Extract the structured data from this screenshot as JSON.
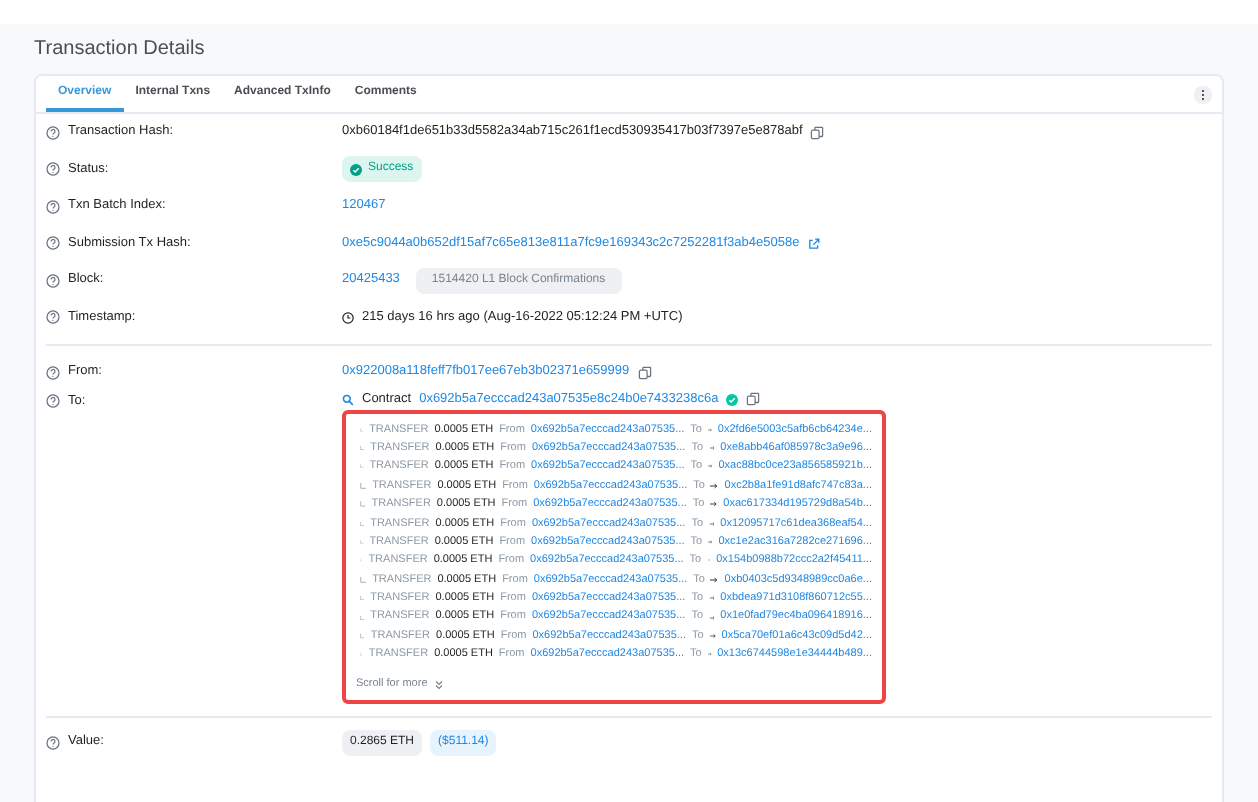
{
  "page_title": "Transaction Details",
  "tabs": [
    {
      "label": "Overview",
      "selected": true
    },
    {
      "label": "Internal Txns",
      "selected": false
    },
    {
      "label": "Advanced TxInfo",
      "selected": false
    },
    {
      "label": "Comments",
      "selected": false
    }
  ],
  "fields": [
    {
      "label": "Transaction Hash:",
      "kind": "hash",
      "value": "0xb60184f1de651b33d5582a34ab715c261f1ecd530935417b03f7397e5e878abf"
    },
    {
      "label": "Status:",
      "kind": "status",
      "value": "Success"
    },
    {
      "label": "Txn Batch Index:",
      "kind": "link",
      "value": "120467"
    },
    {
      "label": "Submission Tx Hash:",
      "kind": "external",
      "value": "0xe5c9044a0b652df15af7c65e813e811a7fc9e169343c2c7252281f3ab4e5058e"
    },
    {
      "label": "Block:",
      "kind": "block",
      "value": "20425433",
      "badge": "1514420 L1 Block Confirmations"
    },
    {
      "label": "Timestamp:",
      "kind": "time",
      "value": "215 days 16 hrs ago (Aug-16-2022 05:12:24 PM +UTC)"
    }
  ],
  "from": {
    "label": "From:",
    "value": "0x922008a118feff7fb017ee67eb3b02371e659999"
  },
  "to": {
    "label": "To:",
    "prefix": "Contract",
    "value": "0x692b5a7ecccad243a07535e8c24b0e7433238c6a",
    "transfers": [
      {
        "type": "TRANSFER",
        "amount": "0.0005 ETH",
        "from_label": "From",
        "from": "0x692b5a7ecccad243a07535...",
        "to_label": "To",
        "to": "0x2fd6e5003c5afb6cb64234e..."
      },
      {
        "type": "TRANSFER",
        "amount": "0.0005 ETH",
        "from_label": "From",
        "from": "0x692b5a7ecccad243a07535...",
        "to_label": "To",
        "to": "0xe8abb46af085978c3a9e96..."
      },
      {
        "type": "TRANSFER",
        "amount": "0.0005 ETH",
        "from_label": "From",
        "from": "0x692b5a7ecccad243a07535...",
        "to_label": "To",
        "to": "0xac88bc0ce23a856585921b..."
      },
      {
        "type": "TRANSFER",
        "amount": "0.0005 ETH",
        "from_label": "From",
        "from": "0x692b5a7ecccad243a07535...",
        "to_label": "To",
        "to": "0xc2b8a1fe91d8afc747c83a..."
      },
      {
        "type": "TRANSFER",
        "amount": "0.0005 ETH",
        "from_label": "From",
        "from": "0x692b5a7ecccad243a07535...",
        "to_label": "To",
        "to": "0xac617334d195729d8a54b..."
      },
      {
        "type": "TRANSFER",
        "amount": "0.0005 ETH",
        "from_label": "From",
        "from": "0x692b5a7ecccad243a07535...",
        "to_label": "To",
        "to": "0x12095717c61dea368eaf54..."
      },
      {
        "type": "TRANSFER",
        "amount": "0.0005 ETH",
        "from_label": "From",
        "from": "0x692b5a7ecccad243a07535...",
        "to_label": "To",
        "to": "0xc1e2ac316a7282ce271696..."
      },
      {
        "type": "TRANSFER",
        "amount": "0.0005 ETH",
        "from_label": "From",
        "from": "0x692b5a7ecccad243a07535...",
        "to_label": "To",
        "to": "0x154b0988b72ccc2a2f45411..."
      },
      {
        "type": "TRANSFER",
        "amount": "0.0005 ETH",
        "from_label": "From",
        "from": "0x692b5a7ecccad243a07535...",
        "to_label": "To",
        "to": "0xb0403c5d9348989cc0a6e..."
      },
      {
        "type": "TRANSFER",
        "amount": "0.0005 ETH",
        "from_label": "From",
        "from": "0x692b5a7ecccad243a07535...",
        "to_label": "To",
        "to": "0xbdea971d3108f860712c55..."
      },
      {
        "type": "TRANSFER",
        "amount": "0.0005 ETH",
        "from_label": "From",
        "from": "0x692b5a7ecccad243a07535...",
        "to_label": "To",
        "to": "0x1e0fad79ec4ba096418916..."
      },
      {
        "type": "TRANSFER",
        "amount": "0.0005 ETH",
        "from_label": "From",
        "from": "0x692b5a7ecccad243a07535...",
        "to_label": "To",
        "to": "0x5ca70ef01a6c43c09d5d42..."
      },
      {
        "type": "TRANSFER",
        "amount": "0.0005 ETH",
        "from_label": "From",
        "from": "0x692b5a7ecccad243a07535...",
        "to_label": "To",
        "to": "0x13c6744598e1e34444b489..."
      }
    ],
    "scroll_hint": "Scroll for more"
  },
  "value": {
    "label": "Value:",
    "amount": "0.2865 ETH",
    "usd": "($511.14)"
  }
}
